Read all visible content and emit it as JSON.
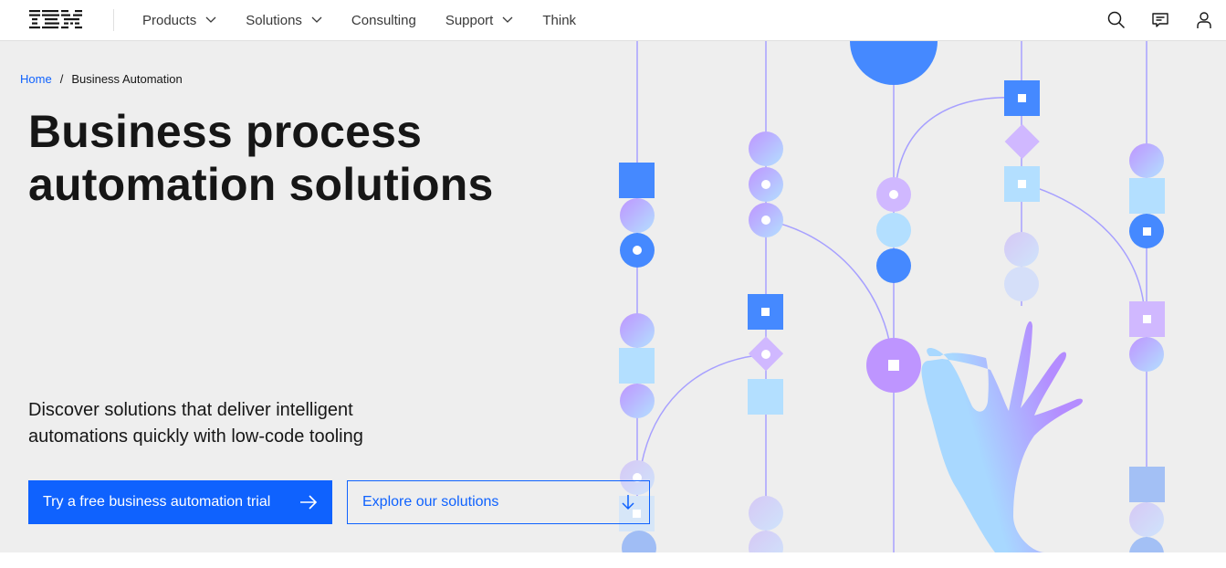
{
  "masthead": {
    "logo": "IBM",
    "nav": [
      {
        "label": "Products",
        "has_dropdown": true
      },
      {
        "label": "Solutions",
        "has_dropdown": true
      },
      {
        "label": "Consulting",
        "has_dropdown": false
      },
      {
        "label": "Support",
        "has_dropdown": true
      },
      {
        "label": "Think",
        "has_dropdown": false
      }
    ],
    "utilities": [
      {
        "icon": "search-icon",
        "label": "Search"
      },
      {
        "icon": "chat-icon",
        "label": "Contact"
      },
      {
        "icon": "user-icon",
        "label": "Profile"
      }
    ]
  },
  "breadcrumb": {
    "items": [
      {
        "label": "Home",
        "link": true
      },
      {
        "label": "Business Automation",
        "link": false
      }
    ],
    "separator": "/"
  },
  "hero": {
    "title_line1": "Business process",
    "title_line2": "automation solutions",
    "lede": "Discover solutions that deliver intelligent automations quickly with low-code tooling",
    "primary_cta": {
      "label": "Try a free business automation trial",
      "icon": "arrow-right-icon"
    },
    "secondary_cta": {
      "label": "Explore our solutions",
      "icon": "arrow-down-icon"
    }
  },
  "colors": {
    "brand_blue": "#0f62fe",
    "hero_bg": "#eeeeee",
    "text": "#161616",
    "art_blue": "#4589ff",
    "art_purple": "#be95ff",
    "art_light_purple": "#d0b8ff",
    "art_light_blue": "#b3dfff",
    "line": "#a7a0ff"
  }
}
